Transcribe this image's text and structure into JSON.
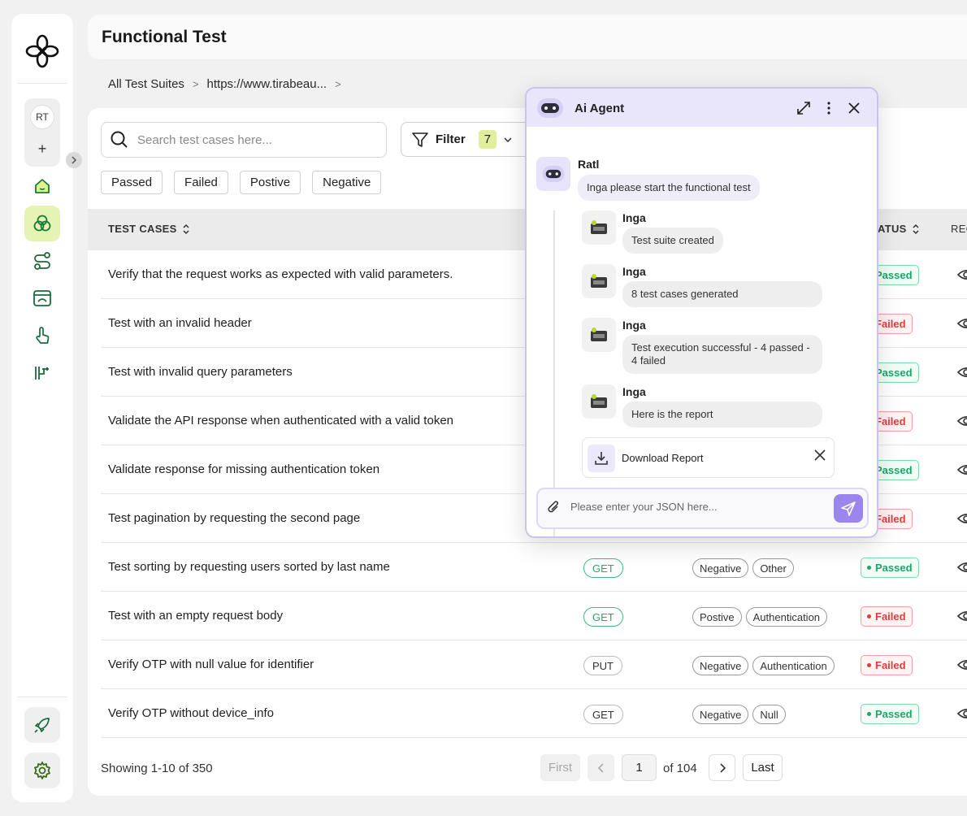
{
  "sidebar": {
    "workspace_initials": "RT",
    "add_label": "+",
    "items": [
      {
        "name": "home-icon"
      },
      {
        "name": "suites-icon",
        "active": true
      },
      {
        "name": "flows-icon"
      },
      {
        "name": "api-icon"
      },
      {
        "name": "tap-icon"
      },
      {
        "name": "pipeline-icon"
      }
    ],
    "bottom_items": [
      {
        "name": "rocket-icon"
      },
      {
        "name": "gear-icon"
      }
    ]
  },
  "header": {
    "title": "Functional Test"
  },
  "breadcrumb": {
    "items": [
      "All Test Suites",
      "https://www.tirabeau..."
    ]
  },
  "search": {
    "placeholder": "Search test cases here..."
  },
  "filter": {
    "label": "Filter",
    "count": "7"
  },
  "chips": [
    "Passed",
    "Failed",
    "Postive",
    "Negative"
  ],
  "table": {
    "headers": {
      "test_cases": "TEST CASES",
      "status": "ATUS",
      "req": "REC"
    },
    "rows": [
      {
        "name": "Verify that the request works as expected with valid parameters.",
        "status": "Passed"
      },
      {
        "name": "Test with an invalid header",
        "status": "Failed"
      },
      {
        "name": "Test with invalid query parameters",
        "status": "Passed"
      },
      {
        "name": "Validate the API response when authenticated with a valid token",
        "status": "Failed"
      },
      {
        "name": "Validate response for missing authentication token",
        "status": "Passed"
      },
      {
        "name": "Test pagination by requesting the second page",
        "status": "Failed"
      },
      {
        "name": "Test sorting by requesting users sorted by last name",
        "method": "GET",
        "tags": [
          "Negative",
          "Other"
        ],
        "status": "Passed"
      },
      {
        "name": "Test with an empty request body",
        "method": "GET",
        "tags": [
          "Postive",
          "Authentication"
        ],
        "status": "Failed"
      },
      {
        "name": "Verify OTP with null value for identifier",
        "method": "PUT",
        "tags": [
          "Negative",
          "Authentication"
        ],
        "status": "Failed"
      },
      {
        "name": "Verify OTP without device_info",
        "method": "GET",
        "tags": [
          "Negative",
          "Null"
        ],
        "status": "Passed"
      }
    ]
  },
  "pagination": {
    "showing": "Showing 1-10 of 350",
    "first": "First",
    "current": "1",
    "of": "of 104",
    "last": "Last"
  },
  "chat": {
    "title": "Ai Agent",
    "messages": [
      {
        "sender": "Ratl",
        "text": "Inga please start the functional test"
      },
      {
        "sender": "Inga",
        "text": "Test suite created"
      },
      {
        "sender": "Inga",
        "text": "8 test cases generated"
      },
      {
        "sender": "Inga",
        "text": "Test execution successful - 4 passed - 4 failed"
      },
      {
        "sender": "Inga",
        "text": "Here is the report"
      }
    ],
    "download_label": "Download Report",
    "input_placeholder": "Please enter your JSON here..."
  },
  "colors": {
    "accent_green": "#e5f3b5",
    "passed": "#19a866",
    "failed": "#e03c3c",
    "chat_purple": "#9b86ed"
  }
}
